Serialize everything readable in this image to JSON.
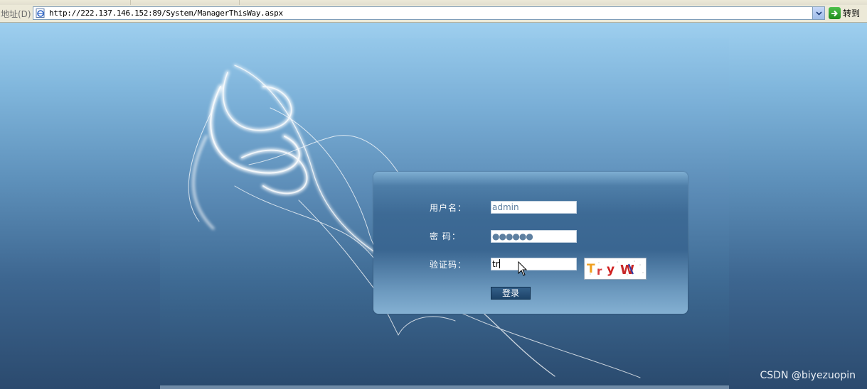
{
  "address_bar": {
    "label": "地址(D)",
    "url": "http://222.137.146.152:89/System/ManagerThisWay.aspx",
    "go_label": "转到"
  },
  "login": {
    "username_label": "用户名：",
    "username_value": "admin",
    "password_label": "密  码：",
    "password_value": "●●●●●●",
    "captcha_label": "验证码：",
    "captcha_value": "tr",
    "captcha_text": "TryW",
    "submit_label": "登录"
  },
  "watermark": "CSDN @biyezuopin",
  "colors": {
    "page_top": "#9ecfef",
    "page_bottom": "#2b4a6e",
    "login_panel": "#3d6a95",
    "button": "#1d4368"
  }
}
